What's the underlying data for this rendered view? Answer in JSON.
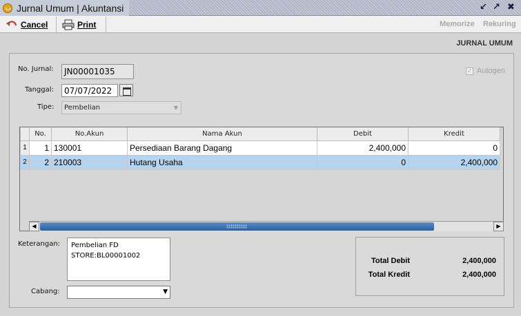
{
  "window": {
    "title": "Jurnal Umum | Akuntansi",
    "controls": [
      "restore-icon",
      "maximize-icon",
      "close-icon"
    ]
  },
  "toolbar": {
    "cancel_label": "Cancel",
    "print_label": "Print",
    "memorize_label": "Memorize",
    "rekuring_label": "Rekuring"
  },
  "form": {
    "header": "JURNAL UMUM",
    "no_jurnal_label": "No. Jurnal:",
    "no_jurnal_value": "JN00001035",
    "tanggal_label": "Tanggal:",
    "tanggal_value": "07/07/2022",
    "tipe_label": "Tipe:",
    "tipe_value": "Pembelian",
    "autogen_label": "Autogen",
    "autogen_checked": true
  },
  "grid": {
    "columns": [
      "No.",
      "No.Akun",
      "Nama Akun",
      "Debit",
      "Kredit"
    ],
    "rows": [
      {
        "rownum": "1",
        "no": "1",
        "akun": "130001",
        "nama": "Persediaan Barang Dagang",
        "debit": "2,400,000",
        "kredit": "0"
      },
      {
        "rownum": "2",
        "no": "2",
        "akun": "210003",
        "nama": "Hutang Usaha",
        "debit": "0",
        "kredit": "2,400,000"
      }
    ],
    "selected_row": 2
  },
  "footer": {
    "keterangan_label": "Keterangan:",
    "keterangan_line1": "Pembelian FD",
    "keterangan_line2": "STORE:BL00001002",
    "cabang_label": "Cabang:",
    "cabang_value": "",
    "total_debit_label": "Total Debit",
    "total_debit_value": "2,400,000",
    "total_kredit_label": "Total Kredit",
    "total_kredit_value": "2,400,000"
  },
  "colors": {
    "selection": "#b6d3ef",
    "scroll_thumb": "#2d5e9e",
    "title_accent": "#e8a317"
  }
}
